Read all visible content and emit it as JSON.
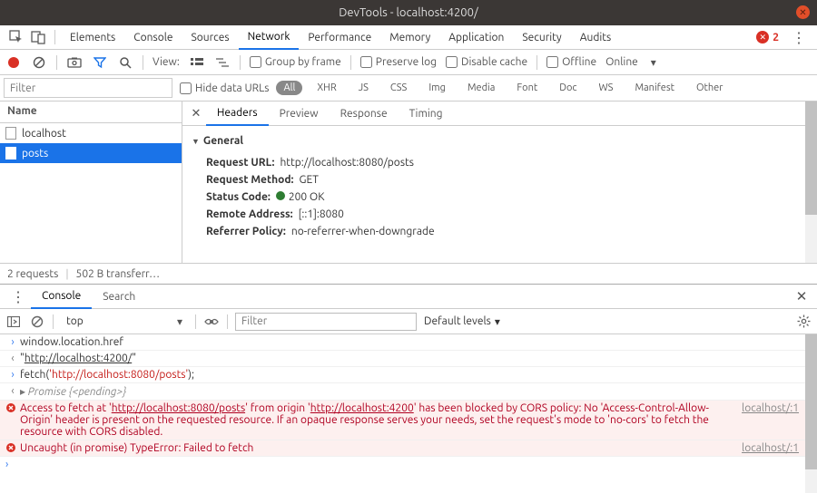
{
  "window": {
    "title": "DevTools - localhost:4200/"
  },
  "panels": {
    "tabs": [
      "Elements",
      "Console",
      "Sources",
      "Network",
      "Performance",
      "Memory",
      "Application",
      "Security",
      "Audits"
    ],
    "active": "Network",
    "error_count": "2"
  },
  "network_toolbar": {
    "view_label": "View:",
    "group_by_frame": "Group by frame",
    "preserve_log": "Preserve log",
    "disable_cache": "Disable cache",
    "offline": "Offline",
    "online": "Online"
  },
  "filter_bar": {
    "filter_placeholder": "Filter",
    "hide_data_urls": "Hide data URLs",
    "types": [
      "All",
      "XHR",
      "JS",
      "CSS",
      "Img",
      "Media",
      "Font",
      "Doc",
      "WS",
      "Manifest",
      "Other"
    ],
    "active_type": "All"
  },
  "requests": {
    "header": "Name",
    "items": [
      {
        "name": "localhost",
        "selected": false
      },
      {
        "name": "posts",
        "selected": true
      }
    ]
  },
  "status_bar": {
    "requests": "2 requests",
    "transferred": "502 B transferr…"
  },
  "detail": {
    "tabs": [
      "Headers",
      "Preview",
      "Response",
      "Timing"
    ],
    "active": "Headers",
    "general_label": "General",
    "rows": {
      "request_url_k": "Request URL:",
      "request_url_v": "http://localhost:8080/posts",
      "request_method_k": "Request Method:",
      "request_method_v": "GET",
      "status_code_k": "Status Code:",
      "status_code_v": "200 OK",
      "remote_addr_k": "Remote Address:",
      "remote_addr_v": "[::1]:8080",
      "referrer_k": "Referrer Policy:",
      "referrer_v": "no-referrer-when-downgrade"
    }
  },
  "drawer": {
    "tabs": [
      "Console",
      "Search"
    ],
    "active": "Console"
  },
  "console_toolbar": {
    "context": "top",
    "filter_placeholder": "Filter",
    "levels": "Default levels"
  },
  "console": {
    "l1": "window.location.href",
    "l2": "\"",
    "l2_url": "http://localhost:4200/",
    "l2_end": "\"",
    "l3_a": "fetch(",
    "l3_b": "'http://localhost:8080/posts'",
    "l3_c": ");",
    "l4_a": "Promise {",
    "l4_b": "<pending>",
    "l4_c": "}",
    "err1_a": "Access to fetch at '",
    "err1_u1": "http://localhost:8080/posts",
    "err1_b": "' from origin '",
    "err1_u2": "http://localhost:4200",
    "err1_c": "' has been blocked by CORS policy: No 'Access-Control-Allow-Origin' header is present on the requested resource. If an opaque response serves your needs, set the request's mode to 'no-cors' to fetch the resource with CORS disabled.",
    "err1_src": "localhost/:1",
    "err2": "Uncaught (in promise) TypeError: Failed to fetch",
    "err2_src": "localhost/:1"
  }
}
